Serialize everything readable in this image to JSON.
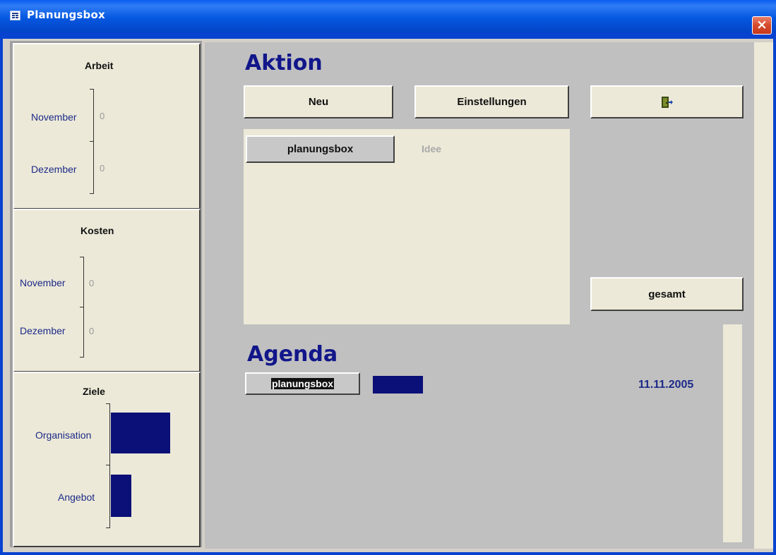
{
  "window": {
    "title": "Planungsbox",
    "close_label": "×"
  },
  "arbeit": {
    "title": "Arbeit",
    "rows": [
      {
        "label": "November",
        "value": "0"
      },
      {
        "label": "Dezember",
        "value": "0"
      }
    ]
  },
  "kosten": {
    "title": "Kosten",
    "rows": [
      {
        "label": "November",
        "value": "0"
      },
      {
        "label": "Dezember",
        "value": "0"
      }
    ]
  },
  "ziele": {
    "title": "Ziele",
    "rows": [
      {
        "label": "Organisation",
        "fraction": 1.0
      },
      {
        "label": "Angebot",
        "fraction": 0.34
      }
    ]
  },
  "aktion": {
    "heading": "Aktion",
    "new_label": "Neu",
    "settings_label": "Einstellungen",
    "exit_icon": "exit-door-icon",
    "item_label": "planungsbox",
    "item_type": "Idee",
    "total_label": "gesamt"
  },
  "agenda": {
    "heading": "Agenda",
    "item_label": "planungsbox",
    "date": "11.11.2005"
  },
  "colors": {
    "accent_text": "#11168a",
    "bar": "#0b0f78",
    "title_bar": "#0558e0"
  }
}
